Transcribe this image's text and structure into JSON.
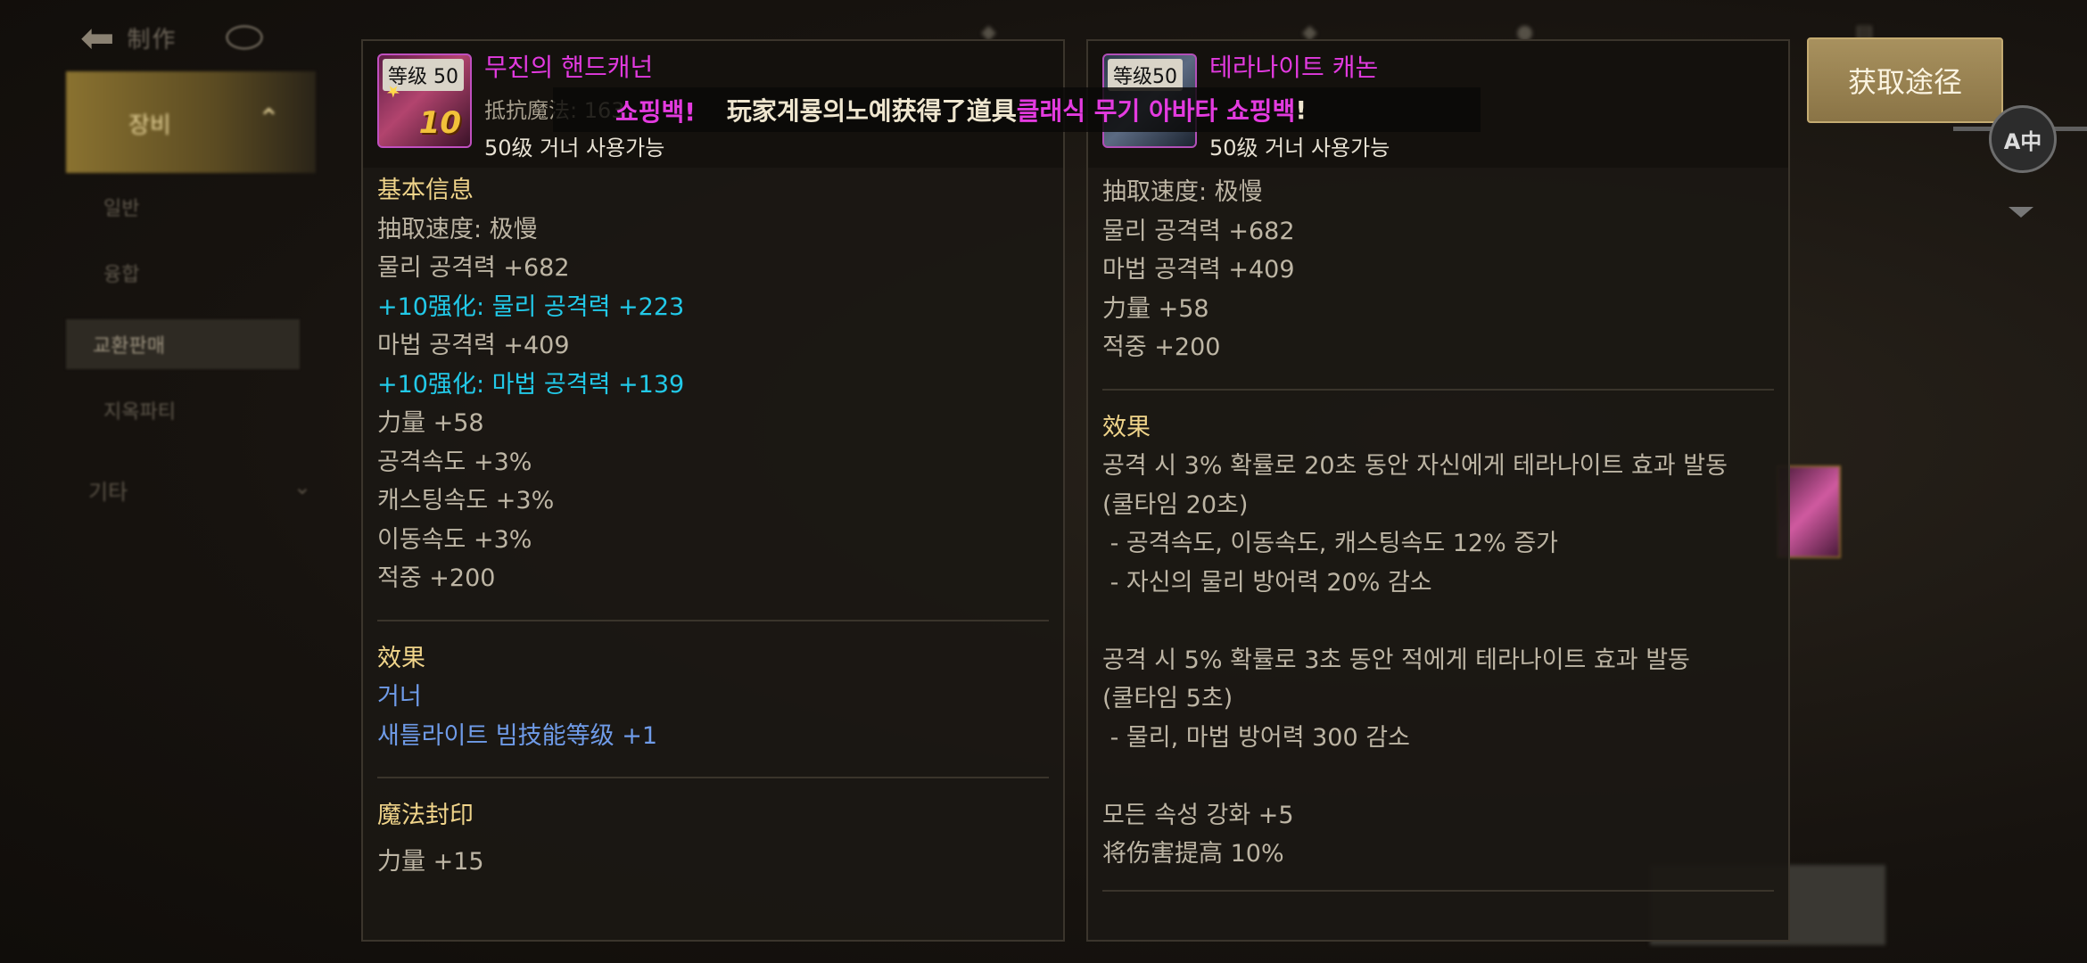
{
  "nav": {
    "title": "制作",
    "tabs": [
      {
        "label": "장비",
        "active": true
      },
      {
        "label": "일반"
      },
      {
        "label": "융합"
      },
      {
        "label": "교환판매",
        "selected": true
      },
      {
        "label": "지옥파티"
      }
    ],
    "other": "기타"
  },
  "left_item": {
    "level_badge": "等级 50",
    "enhance": "10",
    "name": "무진의 핸드캐넌",
    "stat_top": "抵抗魔法: 163",
    "usable": "50级 거너 사용가능",
    "basic_title": "基本信息",
    "lines": [
      {
        "text": "抽取速度:  极慢",
        "color": "gray"
      },
      {
        "text": "물리 공격력 +682",
        "color": "gray"
      },
      {
        "text": "+10强化:  물리 공격력 +223",
        "color": "cyan"
      },
      {
        "text": "마법 공격력 +409",
        "color": "gray"
      },
      {
        "text": "+10强化:  마법 공격력 +139",
        "color": "cyan"
      },
      {
        "text": "力量 +58",
        "color": "gray"
      },
      {
        "text": "공격속도 +3%",
        "color": "gray"
      },
      {
        "text": "캐스팅속도 +3%",
        "color": "gray"
      },
      {
        "text": "이동속도 +3%",
        "color": "gray"
      },
      {
        "text": "적중 +200",
        "color": "gray"
      }
    ],
    "effect_title": "效果",
    "effect_lines": [
      "거너",
      "새틀라이트 빔技能等级 +1"
    ],
    "seal_title": "魔法封印",
    "seal_lines": [
      "力量 +15"
    ]
  },
  "right_item": {
    "level_badge": "等级50",
    "name": "테라나이트 캐논",
    "usable": "50级 거너 사용가능",
    "lines": [
      "抽取速度:  极慢",
      "물리 공격력 +682",
      "마법 공격력 +409",
      "力量 +58",
      "적중 +200"
    ],
    "effect_title": "效果",
    "effect_lines": [
      "공격 시 3% 확률로 20초 동안 자신에게 테라나이트 효과 발동",
      "(쿨타임 20초)",
      " - 공격속도, 이동속도, 캐스팅속도 12% 증가",
      " - 자신의 물리 방어력 20% 감소",
      "",
      "공격 시 5% 확률로 3초 동안 적에게 테라나이트 효과 발동",
      "(쿨타임 5초)",
      " - 물리, 마법 방어력 300 감소",
      "",
      "모든 속성 강화 +5",
      "将伤害提高 10%"
    ]
  },
  "broadcast": {
    "prev_fragment": "쇼핑백!",
    "prefix": "玩家계룡의노예获得了道具",
    "item": "클래식 무기 아바타 쇼핑백",
    "suffix": "!"
  },
  "get_button": "获取途径",
  "translate_badge": "A中",
  "colors": {
    "accent_gold": "#a8915e",
    "name_pink": "#e23adf",
    "cyan": "#22c9e8",
    "blue": "#6f9be8"
  }
}
